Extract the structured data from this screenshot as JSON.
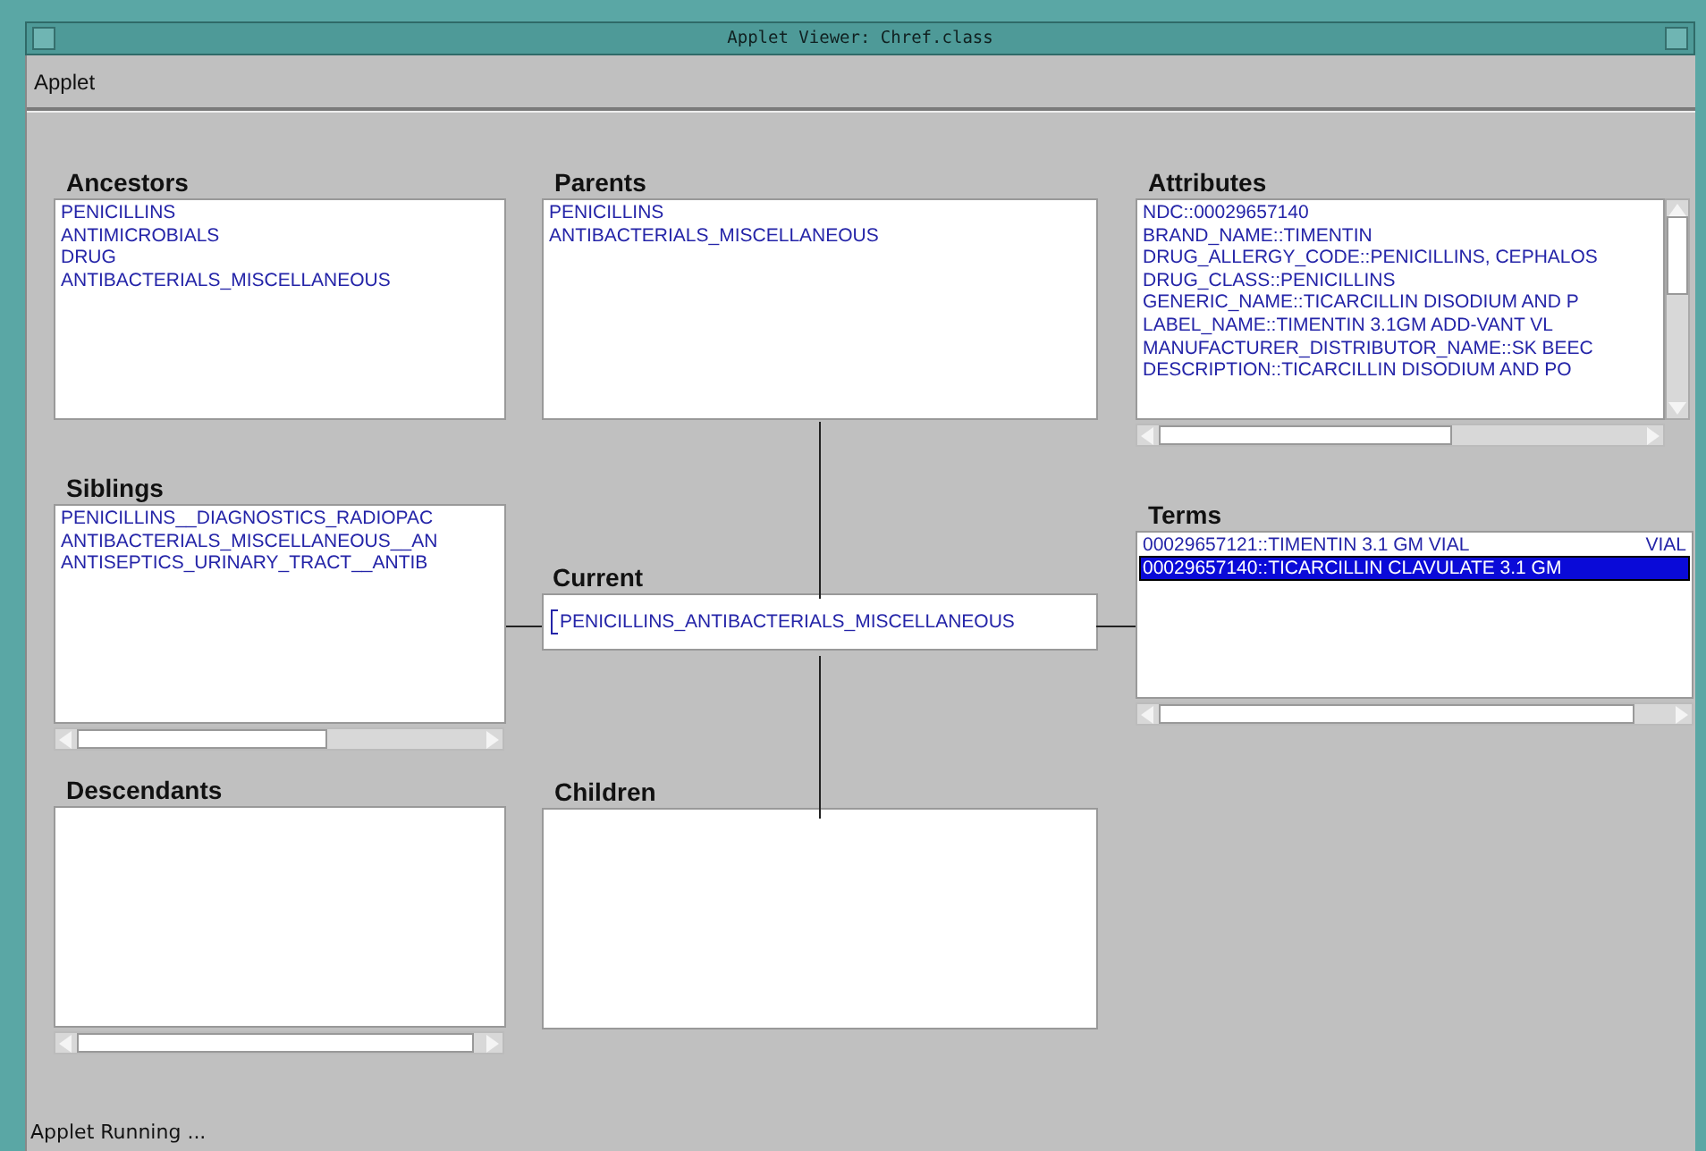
{
  "window": {
    "title": "Applet Viewer: Chref.class"
  },
  "menu": [
    {
      "label": "Applet"
    }
  ],
  "panels": {
    "ancestors": {
      "title": "Ancestors",
      "items": [
        "PENICILLINS",
        "ANTIMICROBIALS",
        "DRUG",
        "ANTIBACTERIALS_MISCELLANEOUS"
      ]
    },
    "parents": {
      "title": "Parents",
      "items": [
        "PENICILLINS",
        "ANTIBACTERIALS_MISCELLANEOUS"
      ]
    },
    "attributes": {
      "title": "Attributes",
      "vertical_scrollbar": true,
      "horizontal_scrollbar": true,
      "items": [
        "NDC::00029657140",
        "BRAND_NAME::TIMENTIN",
        "DRUG_ALLERGY_CODE::PENICILLINS, CEPHALOS",
        "DRUG_CLASS::PENICILLINS",
        "GENERIC_NAME::TICARCILLIN DISODIUM AND P",
        "LABEL_NAME::TIMENTIN 3.1GM ADD-VANT VL",
        "MANUFACTURER_DISTRIBUTOR_NAME::SK BEEC",
        "DESCRIPTION::TICARCILLIN DISODIUM AND PO"
      ]
    },
    "siblings": {
      "title": "Siblings",
      "horizontal_scrollbar": true,
      "items": [
        "PENICILLINS__DIAGNOSTICS_RADIOPAC",
        "ANTIBACTERIALS_MISCELLANEOUS__AN",
        "ANTISEPTICS_URINARY_TRACT__ANTIB"
      ]
    },
    "current": {
      "title": "Current",
      "value": "PENICILLINS_ANTIBACTERIALS_MISCELLANEOUS"
    },
    "terms": {
      "title": "Terms",
      "horizontal_scrollbar": true,
      "rows": [
        {
          "text": "00029657121::TIMENTIN 3.1 GM VIAL",
          "column_2": "VIAL",
          "selected": false
        },
        {
          "text": "00029657140::TICARCILLIN CLAVULATE  3.1 GM",
          "selected": true
        }
      ]
    },
    "descendants": {
      "title": "Descendants",
      "horizontal_scrollbar": true
    },
    "children": {
      "title": "Children"
    }
  },
  "status_bar": "Applet Running ..."
}
